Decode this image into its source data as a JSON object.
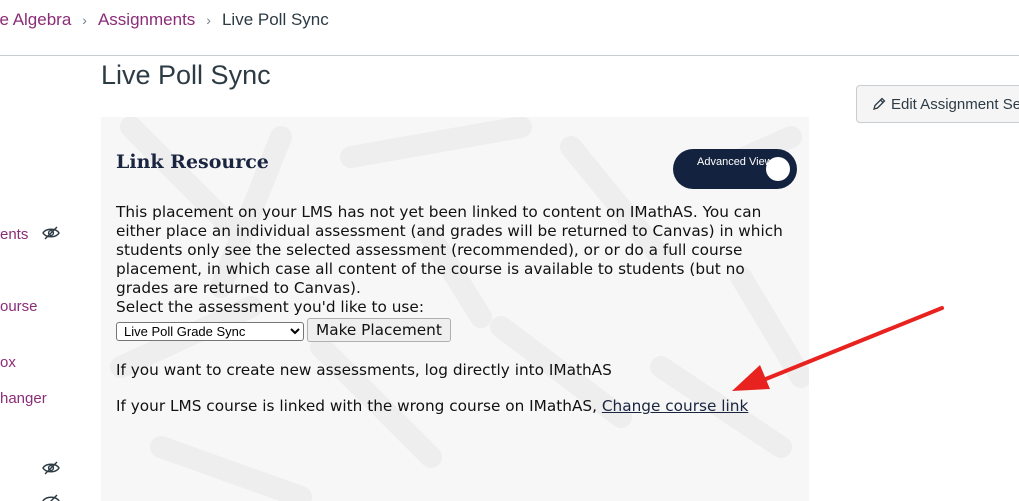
{
  "breadcrumb": {
    "course": "ge Algebra",
    "assignments": "Assignments",
    "current": "Live Poll Sync"
  },
  "nav": {
    "items": [
      "ents",
      "ourse",
      "ox",
      "hanger"
    ]
  },
  "page": {
    "title": "Live Poll Sync",
    "edit_button": "Edit Assignment Se"
  },
  "link_resource": {
    "heading": "Link Resource",
    "toggle_label": "Advanced View",
    "intro": "This placement on your LMS has not yet been linked to content on IMathAS. You can either place an individual assessment (and grades will be returned to Canvas) in which students only see the selected assessment (recommended), or or do a full course placement, in which case all content of the course is available to students (but no grades are returned to Canvas).",
    "select_label": "Select the assessment you'd like to use:",
    "select_value": "Live Poll Grade Sync",
    "make_placement": "Make Placement",
    "create_text": "If you want to create new assessments, log directly into IMathAS",
    "wrong_course_text": "If your LMS course is linked with the wrong course on IMathAS, ",
    "change_link": "Change course link"
  },
  "colors": {
    "link": "#8a2d77",
    "toggle": "#13233f",
    "arrow": "#e8231f"
  },
  "icons": [
    "chevron-right-icon",
    "hidden-eye-icon",
    "pencil-icon"
  ]
}
